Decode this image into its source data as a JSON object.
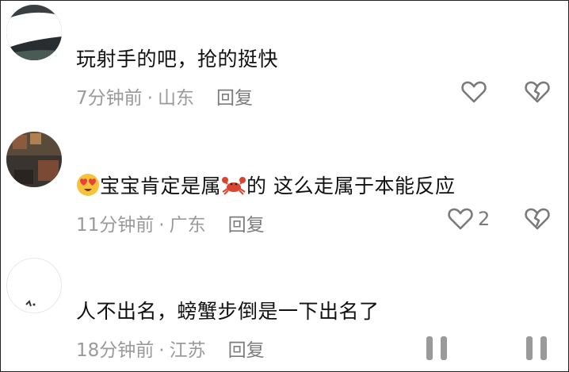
{
  "comments": [
    {
      "text": "玩射手的吧，抢的挺快",
      "time": "7分钟前",
      "location": "山东",
      "reply_label": "回复",
      "like_count": "",
      "avatar_icon": "user-avatar"
    },
    {
      "text_part1": "宝宝肯定是属",
      "text_part2": "的 这么走属于本能反应",
      "time": "11分钟前",
      "location": "广东",
      "reply_label": "回复",
      "like_count": "2",
      "avatar_icon": "user-avatar",
      "emoji_icons": [
        "heart-eyes-emoji",
        "crab-emoji"
      ]
    },
    {
      "text": "人不出名，螃蟹步倒是一下出名了",
      "time": "18分钟前",
      "location": "江苏",
      "reply_label": "回复",
      "like_count": "",
      "avatar_icon": "user-avatar"
    }
  ],
  "separator": "·",
  "colors": {
    "text": "#111111",
    "meta": "#9a9a9a",
    "icon": "#7a7a7a"
  }
}
